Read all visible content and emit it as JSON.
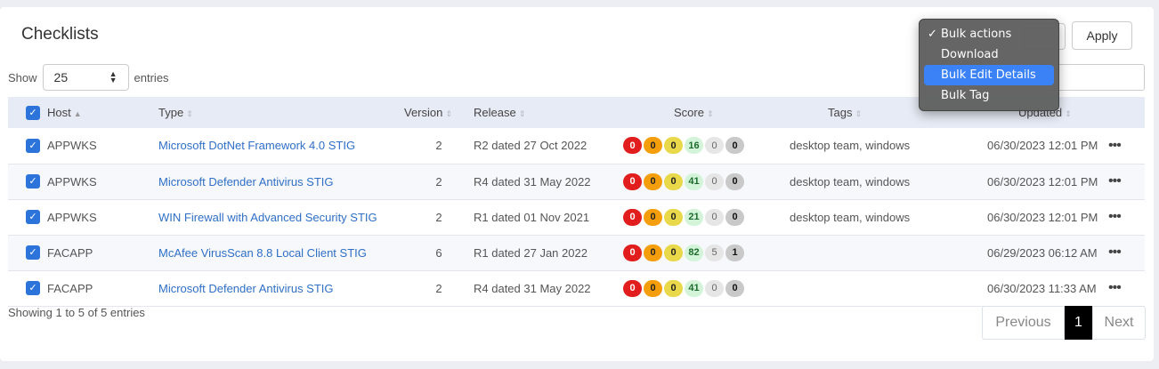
{
  "title": "Checklists",
  "length_menu": {
    "show_label": "Show",
    "value": "25",
    "entries_label": "entries"
  },
  "bulk": {
    "apply_label": "Apply",
    "options": [
      {
        "label": "Bulk actions",
        "checked": true,
        "highlighted": false
      },
      {
        "label": "Download",
        "checked": false,
        "highlighted": false
      },
      {
        "label": "Bulk Edit Details",
        "checked": false,
        "highlighted": true
      },
      {
        "label": "Bulk Tag",
        "checked": false,
        "highlighted": false
      }
    ]
  },
  "columns": {
    "host": "Host",
    "type": "Type",
    "version": "Version",
    "release": "Release",
    "score": "Score",
    "tags": "Tags",
    "updated": "Updated"
  },
  "rows": [
    {
      "host": "APPWKS",
      "type": "Microsoft DotNet Framework 4.0 STIG",
      "version": "2",
      "release": "R2 dated 27 Oct 2022",
      "score": [
        "0",
        "0",
        "0",
        "16",
        "0",
        "0"
      ],
      "tags": "desktop team, windows",
      "updated": "06/30/2023 12:01 PM"
    },
    {
      "host": "APPWKS",
      "type": "Microsoft Defender Antivirus STIG",
      "version": "2",
      "release": "R4 dated 31 May 2022",
      "score": [
        "0",
        "0",
        "0",
        "41",
        "0",
        "0"
      ],
      "tags": "desktop team, windows",
      "updated": "06/30/2023 12:01 PM"
    },
    {
      "host": "APPWKS",
      "type": "WIN Firewall with Advanced Security STIG",
      "version": "2",
      "release": "R1 dated 01 Nov 2021",
      "score": [
        "0",
        "0",
        "0",
        "21",
        "0",
        "0"
      ],
      "tags": "desktop team, windows",
      "updated": "06/30/2023 12:01 PM"
    },
    {
      "host": "FACAPP",
      "type": "McAfee VirusScan 8.8 Local Client STIG",
      "version": "6",
      "release": "R1 dated 27 Jan 2022",
      "score": [
        "0",
        "0",
        "0",
        "82",
        "5",
        "1"
      ],
      "tags": "",
      "updated": "06/29/2023 06:12 AM"
    },
    {
      "host": "FACAPP",
      "type": "Microsoft Defender Antivirus STIG",
      "version": "2",
      "release": "R4 dated 31 May 2022",
      "score": [
        "0",
        "0",
        "0",
        "41",
        "0",
        "0"
      ],
      "tags": "",
      "updated": "06/30/2023 11:33 AM"
    }
  ],
  "row_action_glyph": "•••",
  "footer": {
    "info": "Showing 1 to 5 of 5 entries",
    "previous": "Previous",
    "current_page": "1",
    "next": "Next"
  }
}
